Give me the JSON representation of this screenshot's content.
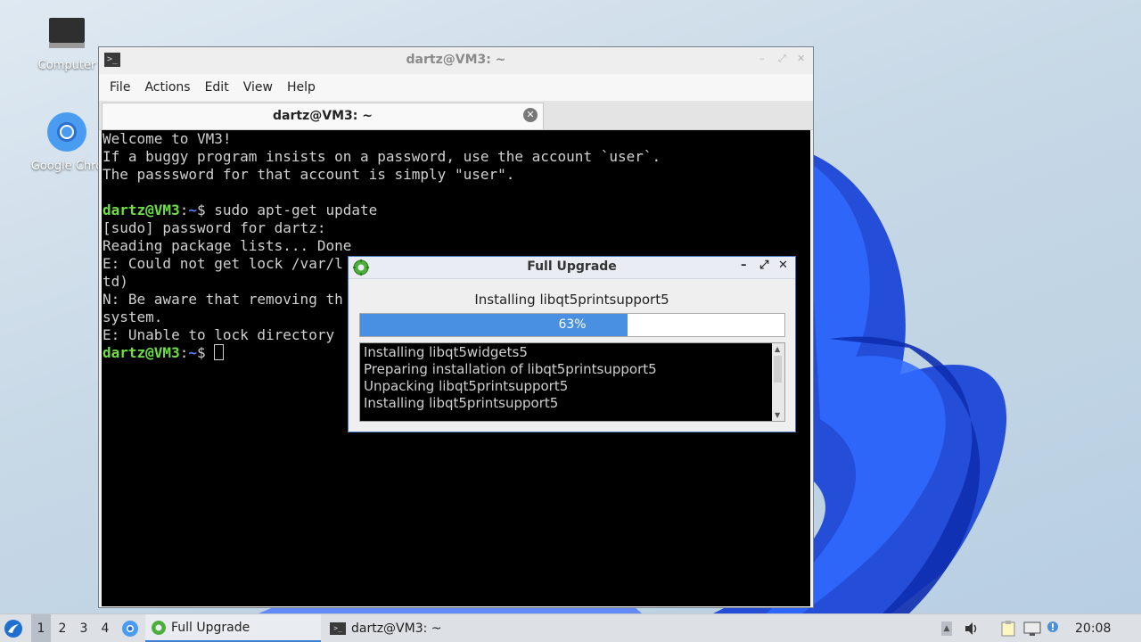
{
  "desktop": {
    "icons": [
      {
        "label": "Computer",
        "icon": "monitor-icon"
      },
      {
        "label": "Google Chro",
        "icon": "chrome-icon"
      }
    ]
  },
  "terminal": {
    "title": "dartz@VM3: ~",
    "menu": [
      "File",
      "Actions",
      "Edit",
      "View",
      "Help"
    ],
    "tab_label": "dartz@VM3: ~",
    "lines": [
      "Welcome to VM3!",
      "If a buggy program insists on a password, use the account `user`.",
      "The passsword for that account is simply \"user\".",
      "",
      "[sudo] password for dartz:",
      "Reading package lists... Done",
      "E: Could not get lock /var/l",
      "td)",
      "N: Be aware that removing th",
      "system.",
      "E: Unable to lock directory "
    ],
    "prompt_user": "dartz@VM3",
    "prompt_sep": ":",
    "prompt_path": "~",
    "prompt_dollar": "$ ",
    "command": "sudo apt-get update"
  },
  "dialog": {
    "title": "Full Upgrade",
    "status": "Installing libqt5printsupport5",
    "progress": 0.63,
    "progress_label": "63%",
    "log": [
      "Installing libqt5widgets5",
      "Preparing installation of libqt5printsupport5",
      "Unpacking libqt5printsupport5",
      "Installing libqt5printsupport5"
    ]
  },
  "taskbar": {
    "workspaces": [
      "1",
      "2",
      "3",
      "4"
    ],
    "active_workspace": "1",
    "tasks": [
      {
        "label": "Full Upgrade",
        "icon": "gear-icon",
        "active": true
      },
      {
        "label": "dartz@VM3: ~",
        "icon": "terminal-icon",
        "active": false
      }
    ],
    "clock": "20:08"
  },
  "colors": {
    "accent": "#4a90e2",
    "prompt_green": "#6ee040",
    "prompt_blue": "#5d7bff"
  }
}
